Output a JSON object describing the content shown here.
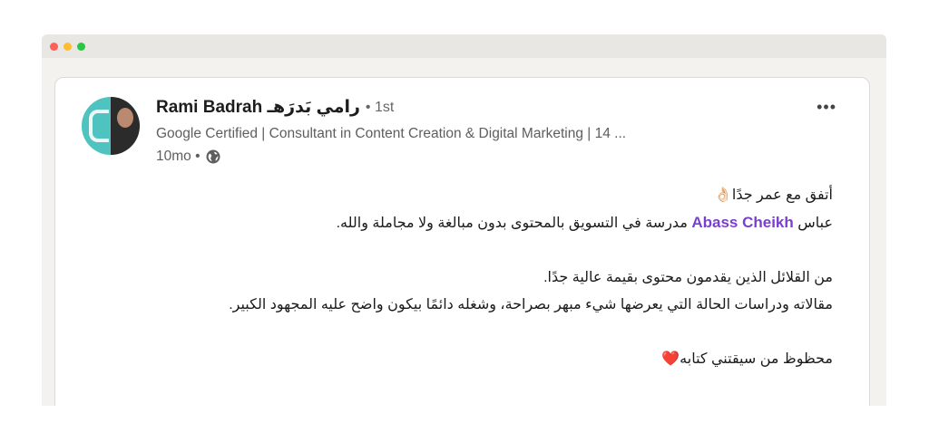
{
  "window": {
    "controls": [
      "close",
      "minimize",
      "zoom"
    ]
  },
  "post": {
    "author": {
      "name": "Rami Badrah رامي بَدرَهـ",
      "degree": "• 1st",
      "headline": "Google Certified | Consultant in Content Creation & Digital Marketing | 14 ...",
      "time": "10mo •",
      "visibility_icon": "globe-icon"
    },
    "more_label": "•••",
    "lines": {
      "l1": "أتفق مع عمر جدًا👌🏻",
      "l2_prefix": "عباس ",
      "l2_mention": "Abass Cheikh",
      "l2_suffix": " مدرسة في التسويق بالمحتوى بدون مبالغة ولا مجاملة والله.",
      "l3": "من القلائل الذين يقدمون محتوى بقيمة عالية جدًا.",
      "l4": "مقالاته ودراسات الحالة التي يعرضها شيء مبهر بصراحة، وشغله دائمًا بيكون واضح عليه المجهود الكبير.",
      "l5": "محظوظ من سيقتني كتابه❤️"
    },
    "mention_color": "#7a3fd0"
  }
}
